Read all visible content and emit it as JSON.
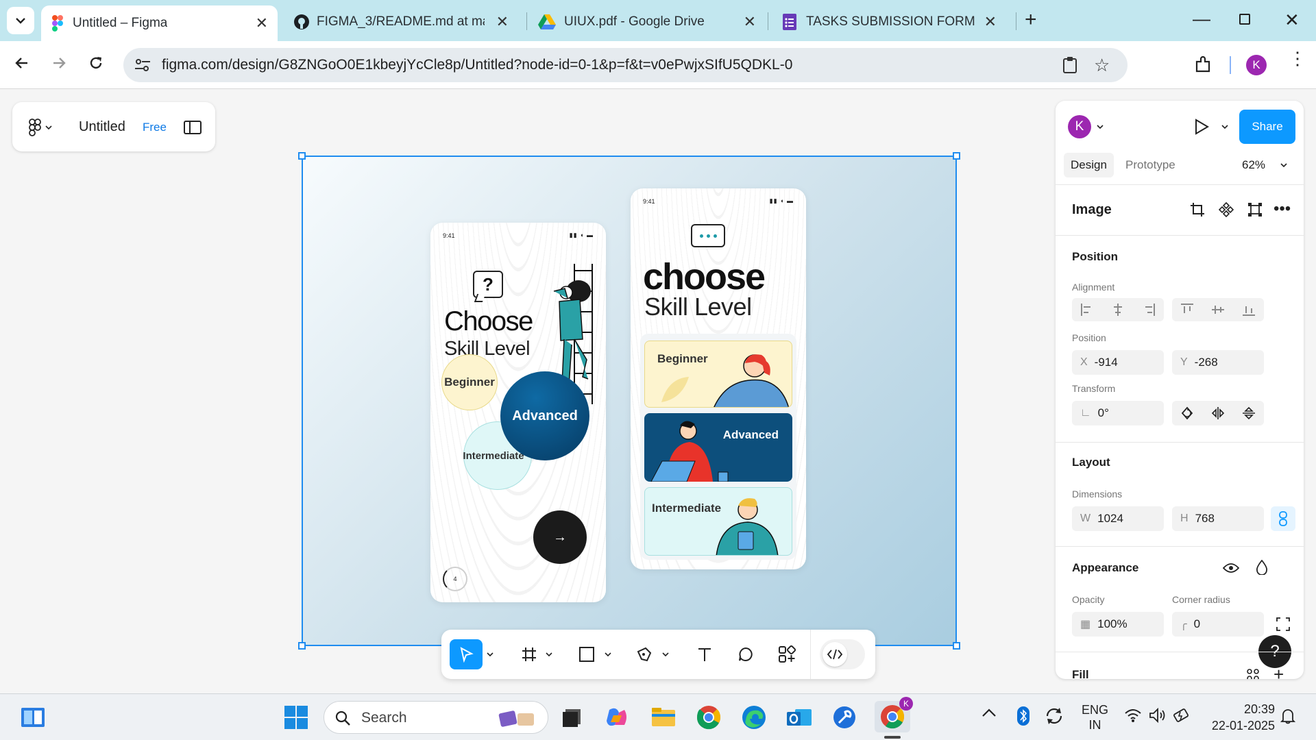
{
  "browser": {
    "tabs": [
      {
        "title": "Untitled – Figma",
        "icon": "figma-icon",
        "active": true
      },
      {
        "title": "FIGMA_3/README.md at main",
        "icon": "github-icon"
      },
      {
        "title": "UIUX.pdf - Google Drive",
        "icon": "google-drive-icon"
      },
      {
        "title": "TASKS SUBMISSION FORM",
        "icon": "google-forms-icon"
      }
    ],
    "url": "figma.com/design/G8ZNGoO0E1kbeyjYcCle8p/Untitled?node-id=0-1&p=f&t=v0ePwjxSIfU5QDKL-0",
    "profile_initial": "K"
  },
  "figma": {
    "file_name": "Untitled",
    "plan_badge": "Free",
    "share_label": "Share",
    "user_initial": "K",
    "tabs": [
      "Design",
      "Prototype"
    ],
    "zoom": "62%",
    "panel": {
      "selection_title": "Image",
      "position_header": "Position",
      "alignment_label": "Alignment",
      "position_label": "Position",
      "x_prefix": "X",
      "x_value": "-914",
      "y_prefix": "Y",
      "y_value": "-268",
      "transform_label": "Transform",
      "rotation": "0°",
      "layout_header": "Layout",
      "dimensions_label": "Dimensions",
      "w_prefix": "W",
      "w_value": "1024",
      "h_prefix": "H",
      "h_value": "768",
      "appearance_header": "Appearance",
      "opacity_label": "Opacity",
      "opacity_value": "100%",
      "corner_radius_label": "Corner radius",
      "corner_radius_value": "0",
      "fill_header": "Fill",
      "help": "?"
    }
  },
  "design": {
    "phone1": {
      "time": "9:41",
      "title_big": "Choose",
      "title_small": "Skill Level",
      "bubble_mark": "?",
      "levels": [
        "Beginner",
        "Advanced",
        "Intermediate"
      ],
      "arrow": "→",
      "page_indicator": "4"
    },
    "phone2": {
      "time": "9:41",
      "title_big": "choose",
      "title_small": "Skill Level",
      "cards": [
        "Beginner",
        "Advanced",
        "Intermediate"
      ]
    },
    "colors": {
      "beginner": "#fdf4cf",
      "advanced": "#0d4f7c",
      "intermediate": "#dff7f7",
      "accent": "#1e8cf0"
    }
  },
  "taskbar": {
    "search_placeholder": "Search",
    "language_1": "ENG",
    "language_2": "IN",
    "time": "20:39",
    "date": "22-01-2025"
  }
}
